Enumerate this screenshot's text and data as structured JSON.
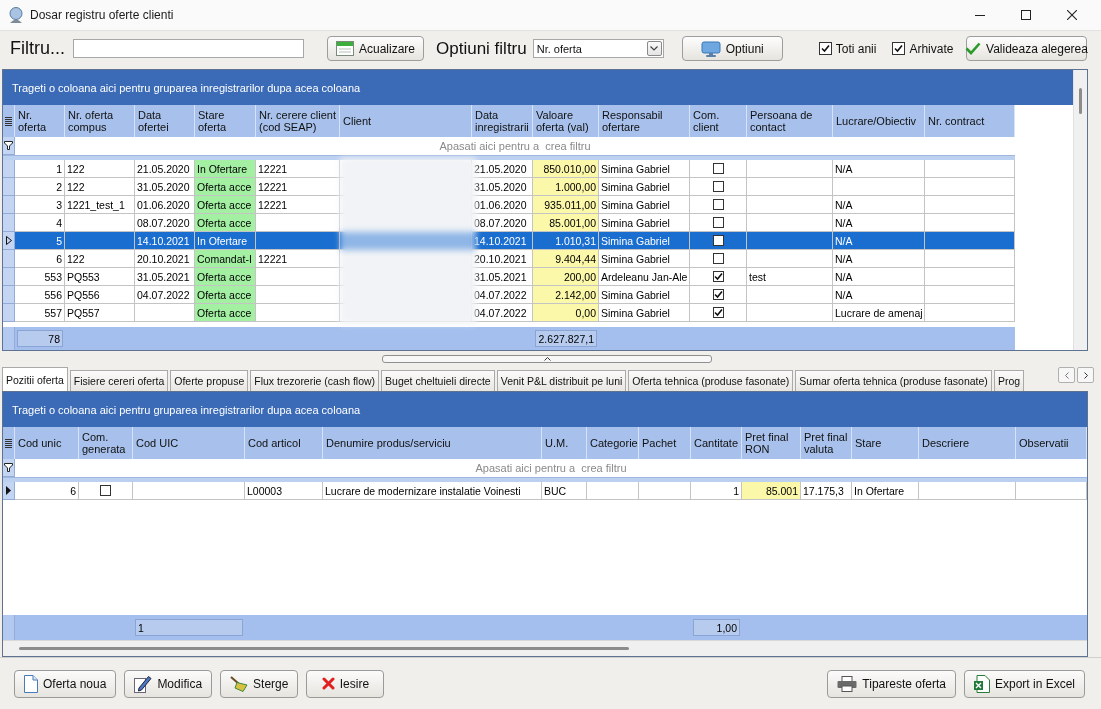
{
  "window": {
    "title": "Dosar registru oferte clienti"
  },
  "toolbar": {
    "filter_label": "Filtru...",
    "refresh_button": "Acualizare",
    "filter_options_label": "Optiuni filtru",
    "filter_options_select": {
      "value": "Nr. oferta"
    },
    "options_button": "Optiuni",
    "checkboxes": [
      {
        "label": "Toti anii",
        "checked": true
      },
      {
        "label": "Arhivate",
        "checked": true
      }
    ],
    "validate_button": "Valideaza alegerea"
  },
  "offers_grid": {
    "group_panel": "Trageti o coloana aici pentru gruparea inregistrarilor dupa acea coloana",
    "columns": [
      "Nr.\noferta",
      "Nr. oferta\ncompus",
      "Data\nofertei",
      "Stare\noferta",
      "Nr. cerere client\n(cod SEAP)",
      "Client",
      "Data\ninregistrarii",
      "Valoare\noferta (val)",
      "Responsabil\nofertare",
      "Com.\nclient",
      "Persoana de\ncontact",
      "Lucrare/Obiectiv",
      "Nr. contract"
    ],
    "filter_row": "Apasati aici pentru a  crea filtru",
    "rows": [
      {
        "selected": false,
        "nr_oferta": "1",
        "nr_oferta_compus": "122",
        "data_ofertei": "21.05.2020",
        "stare_oferta": "In Ofertare",
        "nr_cerere_client": "12221",
        "data_inregistrarii": "21.05.2020",
        "valoare_oferta": "850.010,00",
        "responsabil_ofertare": "Simina Gabriel",
        "com_client": false,
        "lucrare_obiectiv": "N/A"
      },
      {
        "selected": false,
        "nr_oferta": "2",
        "nr_oferta_compus": "122",
        "data_ofertei": "31.05.2020",
        "stare_oferta": "Oferta acce",
        "nr_cerere_client": "12221",
        "data_inregistrarii": "31.05.2020",
        "valoare_oferta": "1.000,00",
        "responsabil_ofertare": "Simina Gabriel",
        "com_client": false
      },
      {
        "selected": false,
        "nr_oferta": "3",
        "nr_oferta_compus": "1221_test_1",
        "data_ofertei": "01.06.2020",
        "stare_oferta": "Oferta acce",
        "nr_cerere_client": "12221",
        "data_inregistrarii": "01.06.2020",
        "valoare_oferta": "935.011,00",
        "responsabil_ofertare": "Simina Gabriel",
        "com_client": false,
        "lucrare_obiectiv": "N/A"
      },
      {
        "selected": false,
        "nr_oferta": "4",
        "data_ofertei": "08.07.2020",
        "stare_oferta": "Oferta acce",
        "data_inregistrarii": "08.07.2020",
        "valoare_oferta": "85.001,00",
        "responsabil_ofertare": "Simina Gabriel",
        "com_client": false,
        "lucrare_obiectiv": "N/A"
      },
      {
        "selected": true,
        "nr_oferta": "5",
        "data_ofertei": "14.10.2021",
        "stare_oferta": "In Ofertare",
        "data_inregistrarii": "14.10.2021",
        "valoare_oferta": "1.010,31",
        "responsabil_ofertare": "Simina Gabriel",
        "com_client": false,
        "lucrare_obiectiv": "N/A"
      },
      {
        "selected": false,
        "nr_oferta": "6",
        "nr_oferta_compus": "122",
        "data_ofertei": "20.10.2021",
        "stare_oferta": "Comandat-I",
        "nr_cerere_client": "12221",
        "data_inregistrarii": "20.10.2021",
        "valoare_oferta": "9.404,44",
        "responsabil_ofertare": "Simina Gabriel",
        "com_client": false,
        "lucrare_obiectiv": "N/A"
      },
      {
        "selected": false,
        "nr_oferta": "553",
        "nr_oferta_compus": "PQ553",
        "data_ofertei": "31.05.2021",
        "stare_oferta": "Oferta acce",
        "data_inregistrarii": "31.05.2021",
        "valoare_oferta": "200,00",
        "responsabil_ofertare": "Ardeleanu Jan-Ale",
        "com_client": true,
        "persoana_de_contact": "test",
        "lucrare_obiectiv": "N/A"
      },
      {
        "selected": false,
        "nr_oferta": "556",
        "nr_oferta_compus": "PQ556",
        "data_ofertei": "04.07.2022",
        "stare_oferta": "Oferta acce",
        "data_inregistrarii": "04.07.2022",
        "valoare_oferta": "2.142,00",
        "responsabil_ofertare": "Simina Gabriel",
        "com_client": true,
        "lucrare_obiectiv": "N/A"
      },
      {
        "selected": false,
        "nr_oferta": "557",
        "nr_oferta_compus": "PQ557",
        "stare_oferta": "Oferta acce",
        "data_inregistrarii": "04.07.2022",
        "valoare_oferta": "0,00",
        "responsabil_ofertare": "Simina Gabriel",
        "com_client": true,
        "lucrare_obiectiv": "Lucrare de amenaj"
      }
    ],
    "footer": {
      "nr_oferta": "78",
      "valoare_oferta": "2.627.827,1"
    }
  },
  "detail_tabs": [
    {
      "label": "Pozitii oferta",
      "selected": true
    },
    {
      "label": "Fisiere cereri oferta",
      "selected": false
    },
    {
      "label": "Oferte propuse",
      "selected": false
    },
    {
      "label": "Flux trezorerie (cash flow)",
      "selected": false
    },
    {
      "label": "Buget cheltuieli directe",
      "selected": false
    },
    {
      "label": "Venit P&L distribuit pe luni",
      "selected": false
    },
    {
      "label": "Oferta tehnica (produse fasonate)",
      "selected": false
    },
    {
      "label": "Sumar oferta tehnica (produse fasonate)",
      "selected": false
    },
    {
      "label": "Prog",
      "selected": false
    }
  ],
  "positions_grid": {
    "group_panel": "Trageti o coloana aici pentru gruparea inregistrarilor dupa acea coloana",
    "columns": [
      "Cod unic",
      "Com.\ngenerata",
      "Cod UIC",
      "Cod articol",
      "Denumire produs/serviciu",
      "U.M.",
      "Categorie",
      "Pachet",
      "Cantitate",
      "Pret final\nRON",
      "Pret final\nvaluta",
      "Stare",
      "Descriere",
      "Observatii"
    ],
    "filter_row": "Apasati aici pentru a  crea filtru",
    "rows": [
      {
        "selected": true,
        "cod_unic": "6",
        "com_generata": false,
        "cod_articol": "L00003",
        "denumire_produs_serviciu": "Lucrare de modernizare instalatie Voinesti",
        "um": "BUC",
        "cantitate": "1",
        "pret_final_ron": "85.001",
        "pret_final_valuta": "17.175,3",
        "stare": "In Ofertare"
      }
    ],
    "footer": {
      "cod_uic": "1",
      "cantitate": "1,00"
    }
  },
  "actions_left": [
    {
      "label": "Oferta noua",
      "kind": "new"
    },
    {
      "label": "Modifica",
      "kind": "edit"
    },
    {
      "label": "Sterge",
      "kind": "delete"
    },
    {
      "label": "Iesire",
      "kind": "exit"
    }
  ],
  "actions_right": [
    {
      "label": "Tipareste oferta",
      "kind": "print"
    },
    {
      "label": "Export in Excel",
      "kind": "export"
    }
  ]
}
